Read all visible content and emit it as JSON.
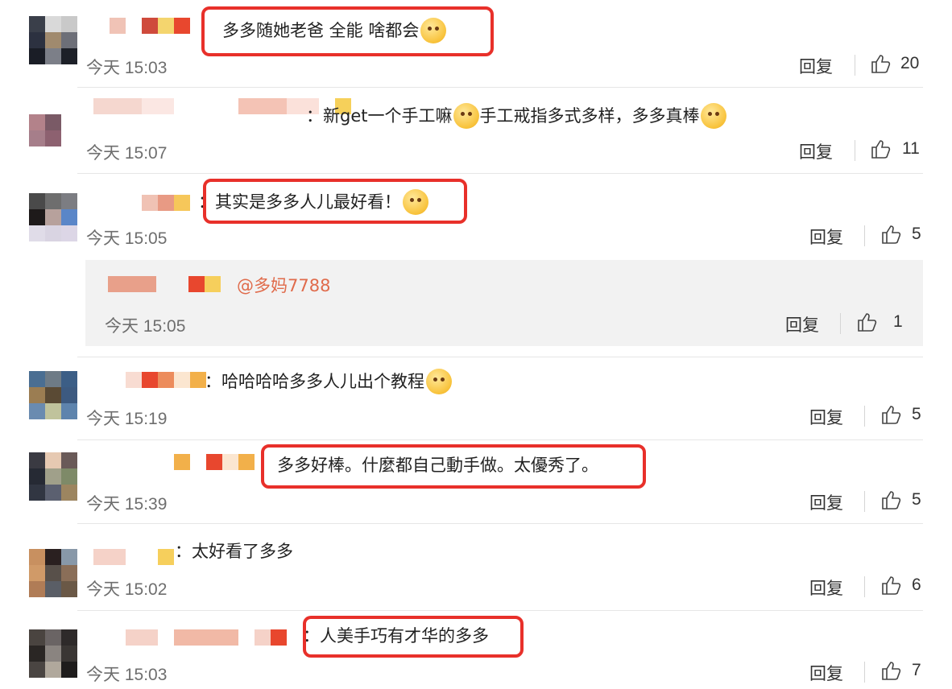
{
  "comments": [
    {
      "time": "今天 15:03",
      "text": "多多随她老爸 全能 啥都会",
      "reply": "回复",
      "likes": "20",
      "emoji": "doge-emoji"
    },
    {
      "time": "今天 15:07",
      "text": "：新get一个手工嘛",
      "text2": "手工戒指多式多样，多多真棒",
      "reply": "回复",
      "likes": "11",
      "emoji": "emoji"
    },
    {
      "time": "今天 15:05",
      "text": "：其实是多多人儿最好看！",
      "reply": "回复",
      "likes": "5",
      "emoji": "kiss-emoji"
    },
    {
      "time": "今天 15:19",
      "text": "：哈哈哈哈多多人儿出个教程",
      "reply": "回复",
      "likes": "5",
      "emoji": "emoji"
    },
    {
      "time": "今天 15:39",
      "text": "多多好棒。什麼都自己動手做。太優秀了。",
      "reply": "回复",
      "likes": "5"
    },
    {
      "time": "今天 15:02",
      "text": "：太好看了多多",
      "reply": "回复",
      "likes": "6"
    },
    {
      "time": "今天 15:03",
      "text": "：人美手巧有才华的多多",
      "reply": "回复",
      "likes": "7"
    }
  ],
  "nested_reply": {
    "mention": "@多妈7788",
    "time": "今天 15:05",
    "reply": "回复",
    "likes": "1"
  },
  "colors": {
    "highlight": "#e8302a",
    "mention": "#e06b4b",
    "time": "#6e6e6e"
  }
}
